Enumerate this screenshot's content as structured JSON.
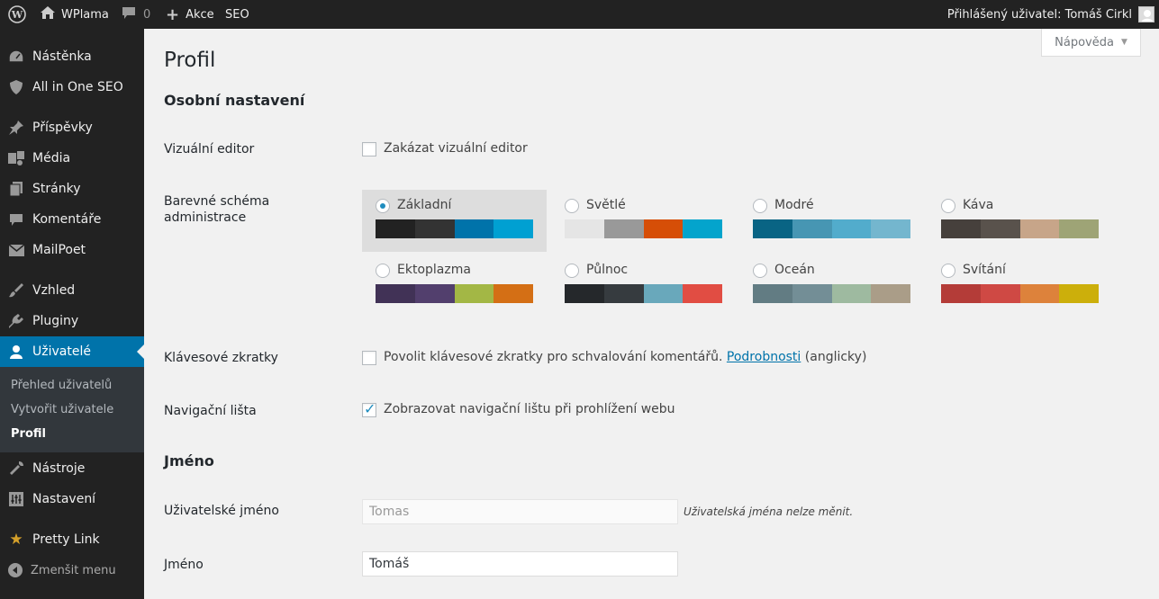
{
  "adminbar": {
    "site_name": "WPlama",
    "comments_count": "0",
    "new_label": "Akce",
    "seo_label": "SEO",
    "user_greeting": "Přihlášený uživatel: Tomáš Cirkl"
  },
  "sidebar": {
    "items": [
      {
        "label": "Nástěnka",
        "icon": "dashboard-icon"
      },
      {
        "label": "All in One SEO",
        "icon": "shield-icon"
      },
      {
        "label": "Příspěvky",
        "icon": "pin-icon"
      },
      {
        "label": "Média",
        "icon": "media-icon"
      },
      {
        "label": "Stránky",
        "icon": "pages-icon"
      },
      {
        "label": "Komentáře",
        "icon": "comment-icon"
      },
      {
        "label": "MailPoet",
        "icon": "mail-icon"
      },
      {
        "label": "Vzhled",
        "icon": "brush-icon"
      },
      {
        "label": "Pluginy",
        "icon": "plugin-icon"
      },
      {
        "label": "Uživatelé",
        "icon": "user-icon"
      },
      {
        "label": "Nástroje",
        "icon": "wrench-icon"
      },
      {
        "label": "Nastavení",
        "icon": "settings-icon"
      },
      {
        "label": "Pretty Link",
        "icon": "star-icon"
      }
    ],
    "submenu": [
      "Přehled uživatelů",
      "Vytvořit uživatele",
      "Profil"
    ],
    "collapse_label": "Zmenšit menu"
  },
  "help_tab": "Nápověda",
  "page_title": "Profil",
  "personal": {
    "title": "Osobní nastavení",
    "visual_editor": {
      "label": "Vizuální editor",
      "option": "Zakázat vizuální editor",
      "checked": false
    },
    "color_scheme": {
      "label_line1": "Barevné schéma",
      "label_line2": "administrace",
      "schemes": [
        {
          "name": "Základní",
          "selected": true,
          "colors": [
            "#222222",
            "#333333",
            "#0073aa",
            "#00a0d2"
          ]
        },
        {
          "name": "Světlé",
          "selected": false,
          "colors": [
            "#e5e5e5",
            "#999999",
            "#d64e07",
            "#04a4cc"
          ]
        },
        {
          "name": "Modré",
          "selected": false,
          "colors": [
            "#096484",
            "#4796b3",
            "#52accc",
            "#74b6ce"
          ]
        },
        {
          "name": "Káva",
          "selected": false,
          "colors": [
            "#46403c",
            "#59524c",
            "#c7a589",
            "#9ea476"
          ]
        },
        {
          "name": "Ektoplazma",
          "selected": false,
          "colors": [
            "#413256",
            "#523f6d",
            "#a3b745",
            "#d46f15"
          ]
        },
        {
          "name": "Půlnoc",
          "selected": false,
          "colors": [
            "#25282b",
            "#363b3f",
            "#69a8bb",
            "#e14d43"
          ]
        },
        {
          "name": "Oceán",
          "selected": false,
          "colors": [
            "#627c83",
            "#738e96",
            "#9ebaa0",
            "#aa9d88"
          ]
        },
        {
          "name": "Svítání",
          "selected": false,
          "colors": [
            "#b43c38",
            "#cf4944",
            "#dd823b",
            "#ccaf0b"
          ]
        }
      ]
    },
    "shortcuts": {
      "label": "Klávesové zkratky",
      "option": "Povolit klávesové zkratky pro schvalování komentářů.",
      "link": "Podrobnosti",
      "suffix": "(anglicky)",
      "checked": false
    },
    "toolbar": {
      "label": "Navigační lišta",
      "option": "Zobrazovat navigační lištu při prohlížení webu",
      "checked": true
    }
  },
  "name_section": {
    "title": "Jméno",
    "username": {
      "label": "Uživatelské jméno",
      "value": "Tomas",
      "note": "Uživatelská jména nelze měnit."
    },
    "first_name": {
      "label": "Jméno",
      "value": "Tomáš"
    }
  }
}
